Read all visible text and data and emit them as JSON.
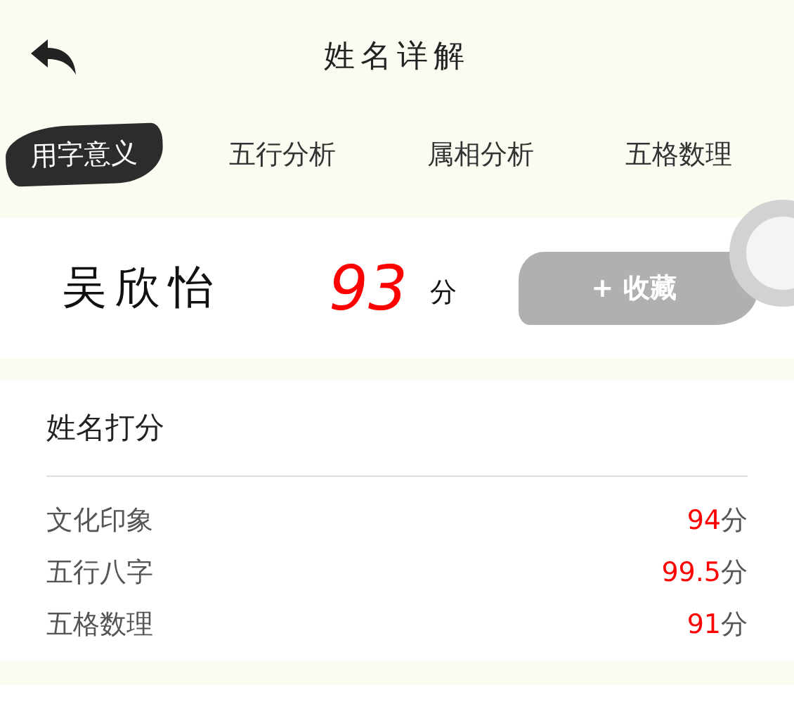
{
  "header": {
    "title": "姓名详解"
  },
  "tabs": [
    {
      "label": "用字意义",
      "selected": true
    },
    {
      "label": "五行分析",
      "selected": false
    },
    {
      "label": "属相分析",
      "selected": false
    },
    {
      "label": "五格数理",
      "selected": false
    }
  ],
  "name_card": {
    "name": "吴欣怡",
    "score": "93",
    "unit": "分",
    "favorite_button": "+ 收藏"
  },
  "score_card": {
    "title": "姓名打分",
    "rows": [
      {
        "label": "文化印象",
        "value": "94",
        "unit": "分"
      },
      {
        "label": "五行八字",
        "value": "99.5",
        "unit": "分"
      },
      {
        "label": "五格数理",
        "value": "91",
        "unit": "分"
      }
    ]
  }
}
